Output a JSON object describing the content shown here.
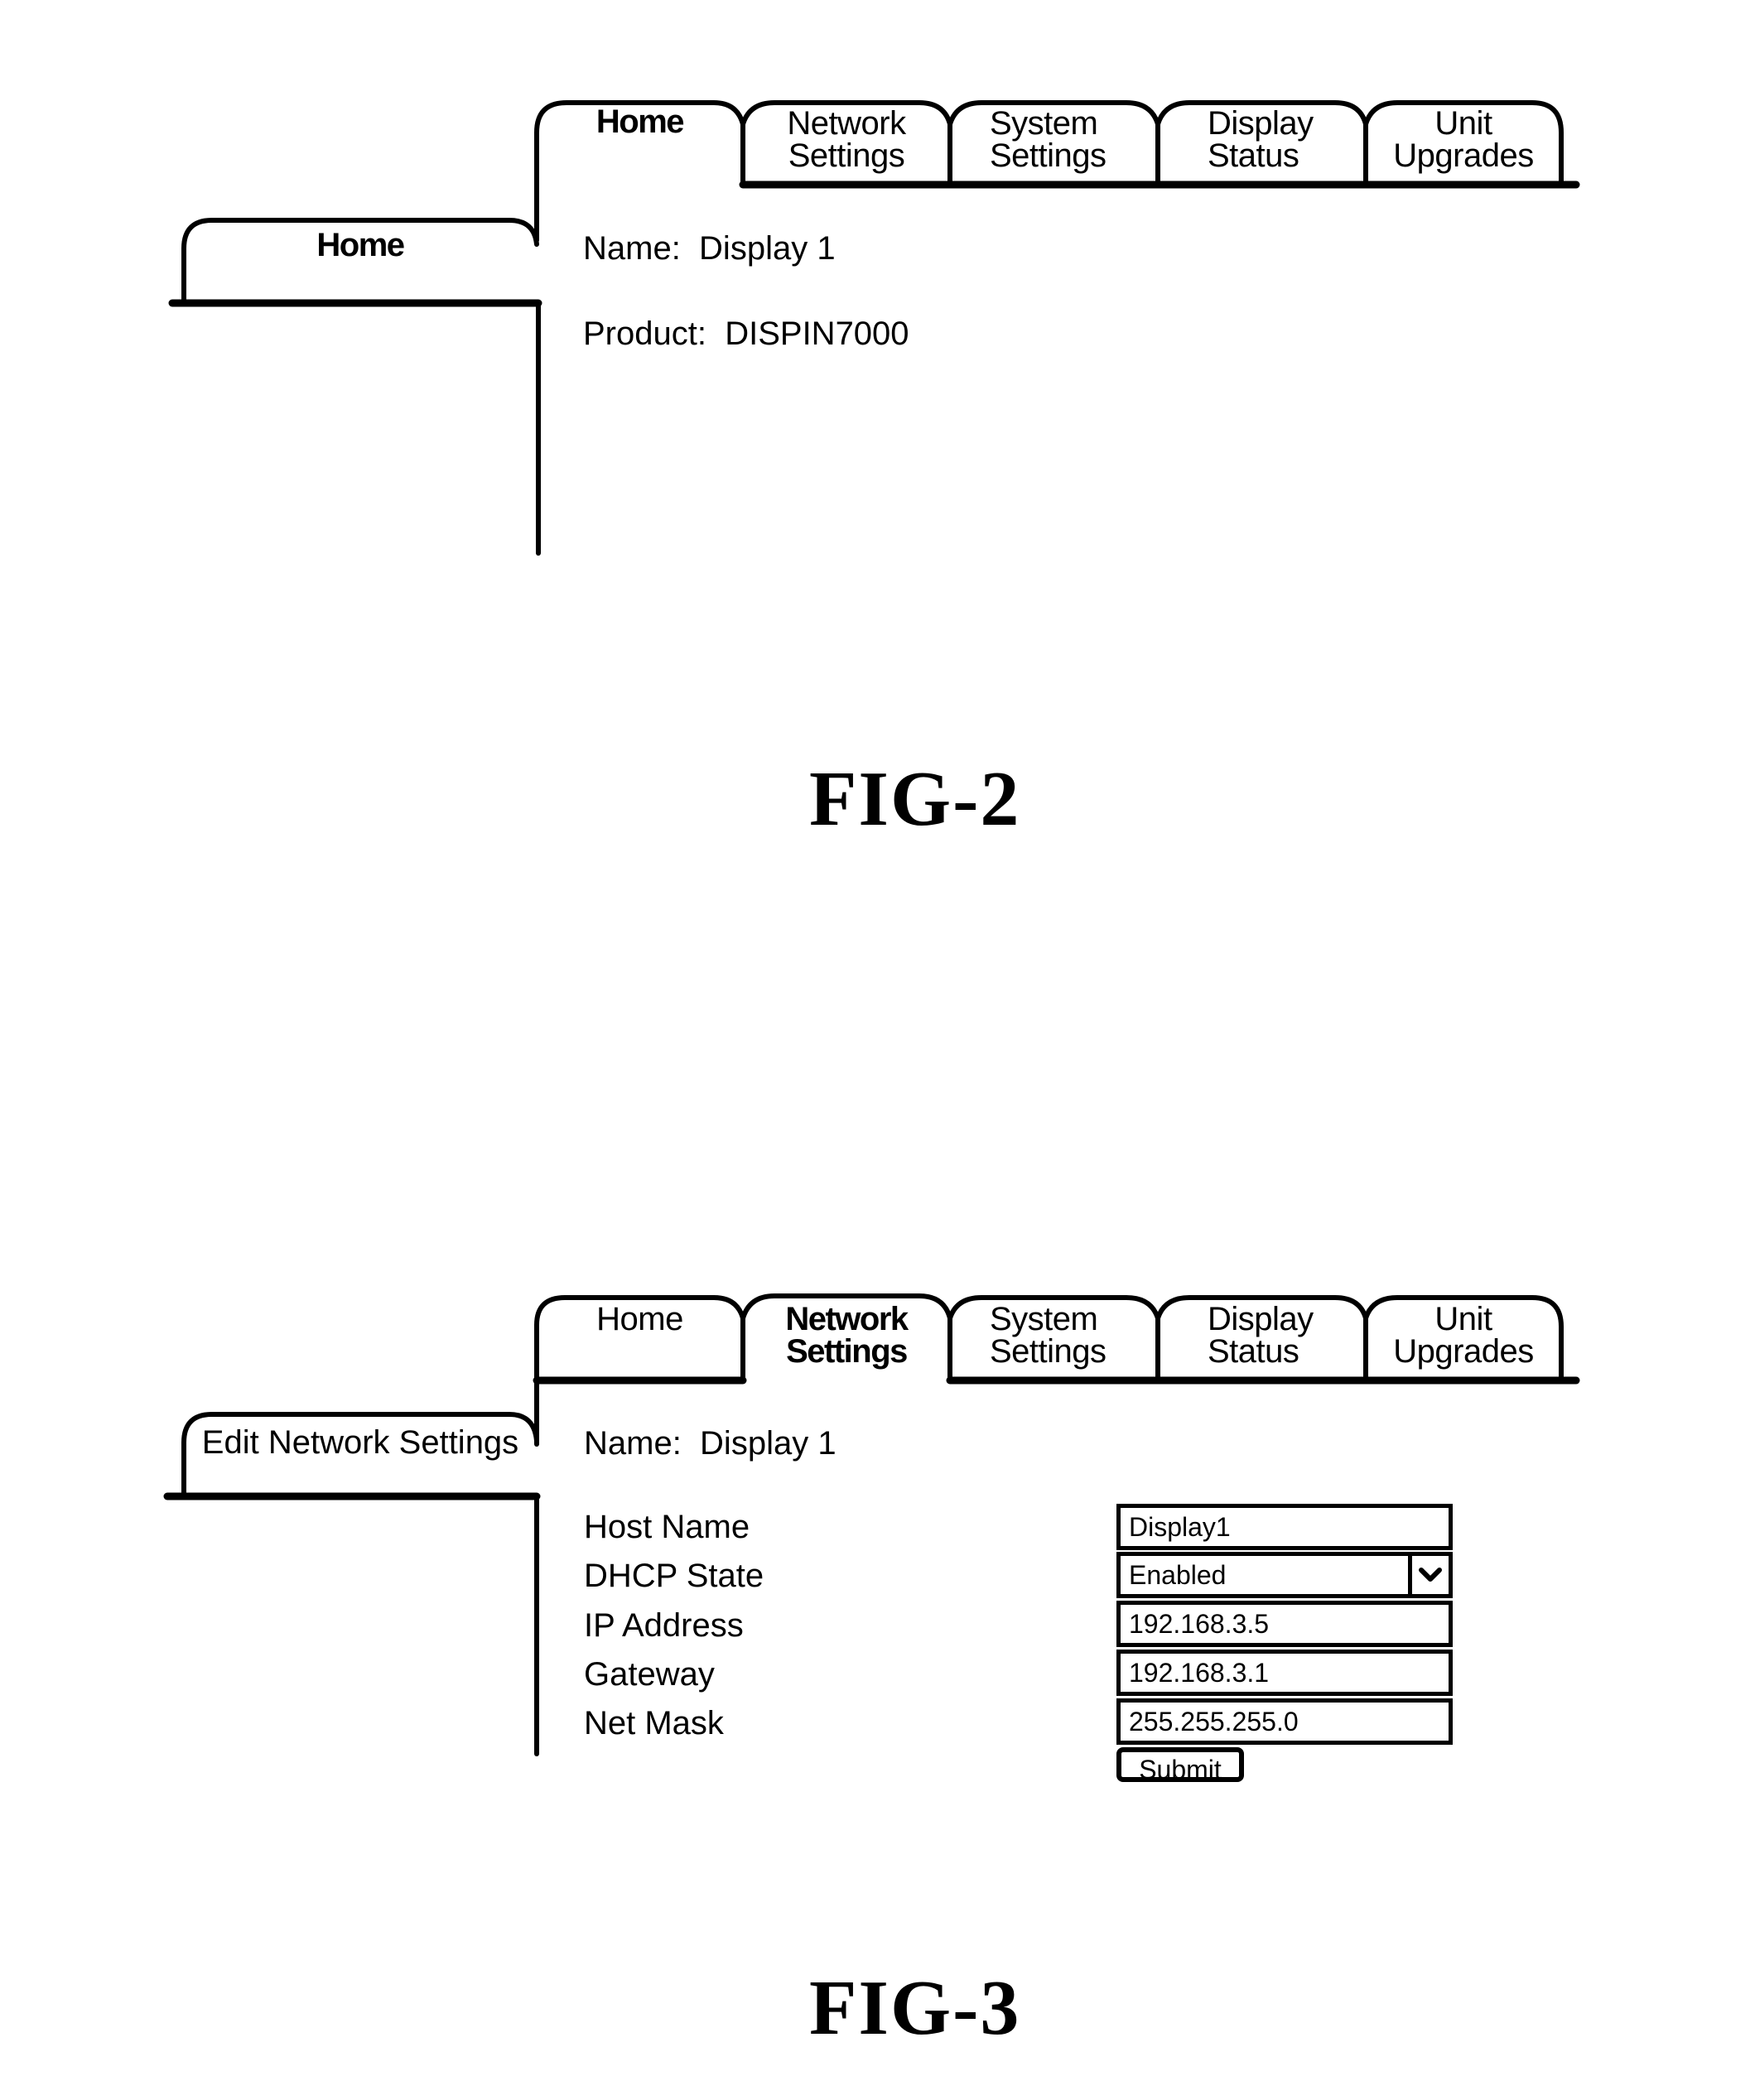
{
  "fig2": {
    "caption": "FIG-2",
    "tabs": [
      {
        "label_line1": "Home",
        "label_line2": "",
        "active": true
      },
      {
        "label_line1": "Network",
        "label_line2": "Settings",
        "active": false
      },
      {
        "label_line1": "System",
        "label_line2": "Settings",
        "active": false
      },
      {
        "label_line1": "Display",
        "label_line2": "Status",
        "active": false
      },
      {
        "label_line1": "Unit",
        "label_line2": "Upgrades",
        "active": false
      }
    ],
    "side_tab": "Home",
    "content": {
      "name_label": "Name:",
      "name_value": "Display 1",
      "product_label": "Product:",
      "product_value": "DISPIN7000"
    }
  },
  "fig3": {
    "caption": "FIG-3",
    "tabs": [
      {
        "label_line1": "Home",
        "label_line2": "",
        "active": false
      },
      {
        "label_line1": "Network",
        "label_line2": "Settings",
        "active": true
      },
      {
        "label_line1": "System",
        "label_line2": "Settings",
        "active": false
      },
      {
        "label_line1": "Display",
        "label_line2": "Status",
        "active": false
      },
      {
        "label_line1": "Unit",
        "label_line2": "Upgrades",
        "active": false
      }
    ],
    "side_tab": "Edit Network Settings",
    "content": {
      "name_label": "Name:",
      "name_value": "Display 1"
    },
    "form": {
      "fields": [
        {
          "label": "Host Name",
          "value": "Display1",
          "type": "text"
        },
        {
          "label": "DHCP State",
          "value": "Enabled",
          "type": "select",
          "icon": "chevron-down-icon"
        },
        {
          "label": "IP Address",
          "value": "192.168.3.5",
          "type": "text"
        },
        {
          "label": "Gateway",
          "value": "192.168.3.1",
          "type": "text"
        },
        {
          "label": "Net Mask",
          "value": "255.255.255.0",
          "type": "text"
        }
      ],
      "submit_label": "Submit"
    }
  }
}
